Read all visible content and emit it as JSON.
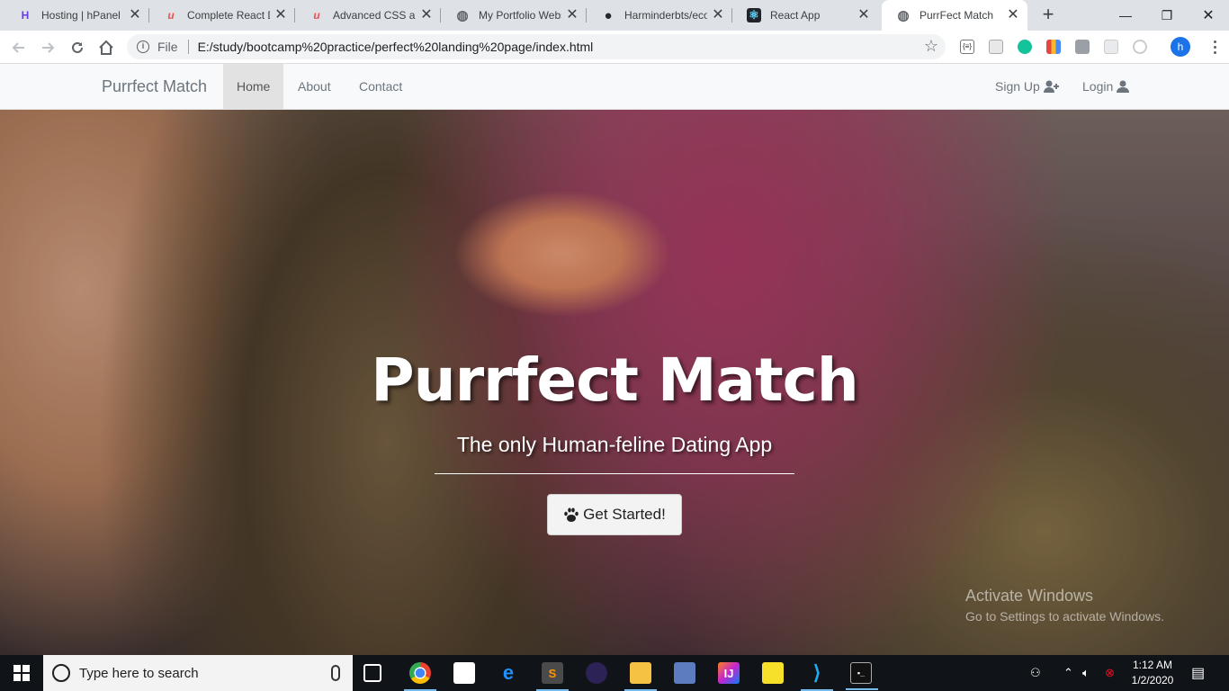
{
  "browser": {
    "tabs": [
      {
        "title": "Hosting | hPanel",
        "favicon": "hostinger-icon",
        "color": "#673de6",
        "glyph": "H"
      },
      {
        "title": "Complete React Dev",
        "favicon": "udemy-icon",
        "color": "#ec5252",
        "glyph": "u"
      },
      {
        "title": "Advanced CSS and",
        "favicon": "udemy-icon",
        "color": "#ec5252",
        "glyph": "u"
      },
      {
        "title": "My Portfolio Webs",
        "favicon": "globe-icon",
        "color": "#5f6368",
        "glyph": "◍"
      },
      {
        "title": "Harminderbts/eco",
        "favicon": "github-icon",
        "color": "#24292e",
        "glyph": "●"
      },
      {
        "title": "React App",
        "favicon": "react-icon",
        "color": "#61dafb",
        "glyph": "⚛"
      },
      {
        "title": "PurrFect Match",
        "favicon": "globe-icon",
        "color": "#5f6368",
        "glyph": "◍"
      }
    ],
    "close_glyph": "✕",
    "new_tab_glyph": "+",
    "window_controls": {
      "minimize": "—",
      "maximize": "❐",
      "close": "✕"
    },
    "address": {
      "scheme_label": "File",
      "url": "E:/study/bootcamp%20practice/perfect%20landing%20page/index.html",
      "star_glyph": "☆"
    },
    "profile_initial": "h"
  },
  "site": {
    "brand": "Purrfect Match",
    "nav": [
      {
        "label": "Home",
        "active": true
      },
      {
        "label": "About",
        "active": false
      },
      {
        "label": "Contact",
        "active": false
      }
    ],
    "nav_right": {
      "signup": "Sign Up",
      "login": "Login"
    },
    "hero": {
      "title": "Purrfect Match",
      "subtitle": "The only Human-feline Dating App",
      "cta": "Get Started!"
    }
  },
  "watermark": {
    "line1": "Activate Windows",
    "line2": "Go to Settings to activate Windows."
  },
  "taskbar": {
    "search_placeholder": "Type here to search",
    "time": "1:12 AM",
    "date": "1/2/2020"
  }
}
